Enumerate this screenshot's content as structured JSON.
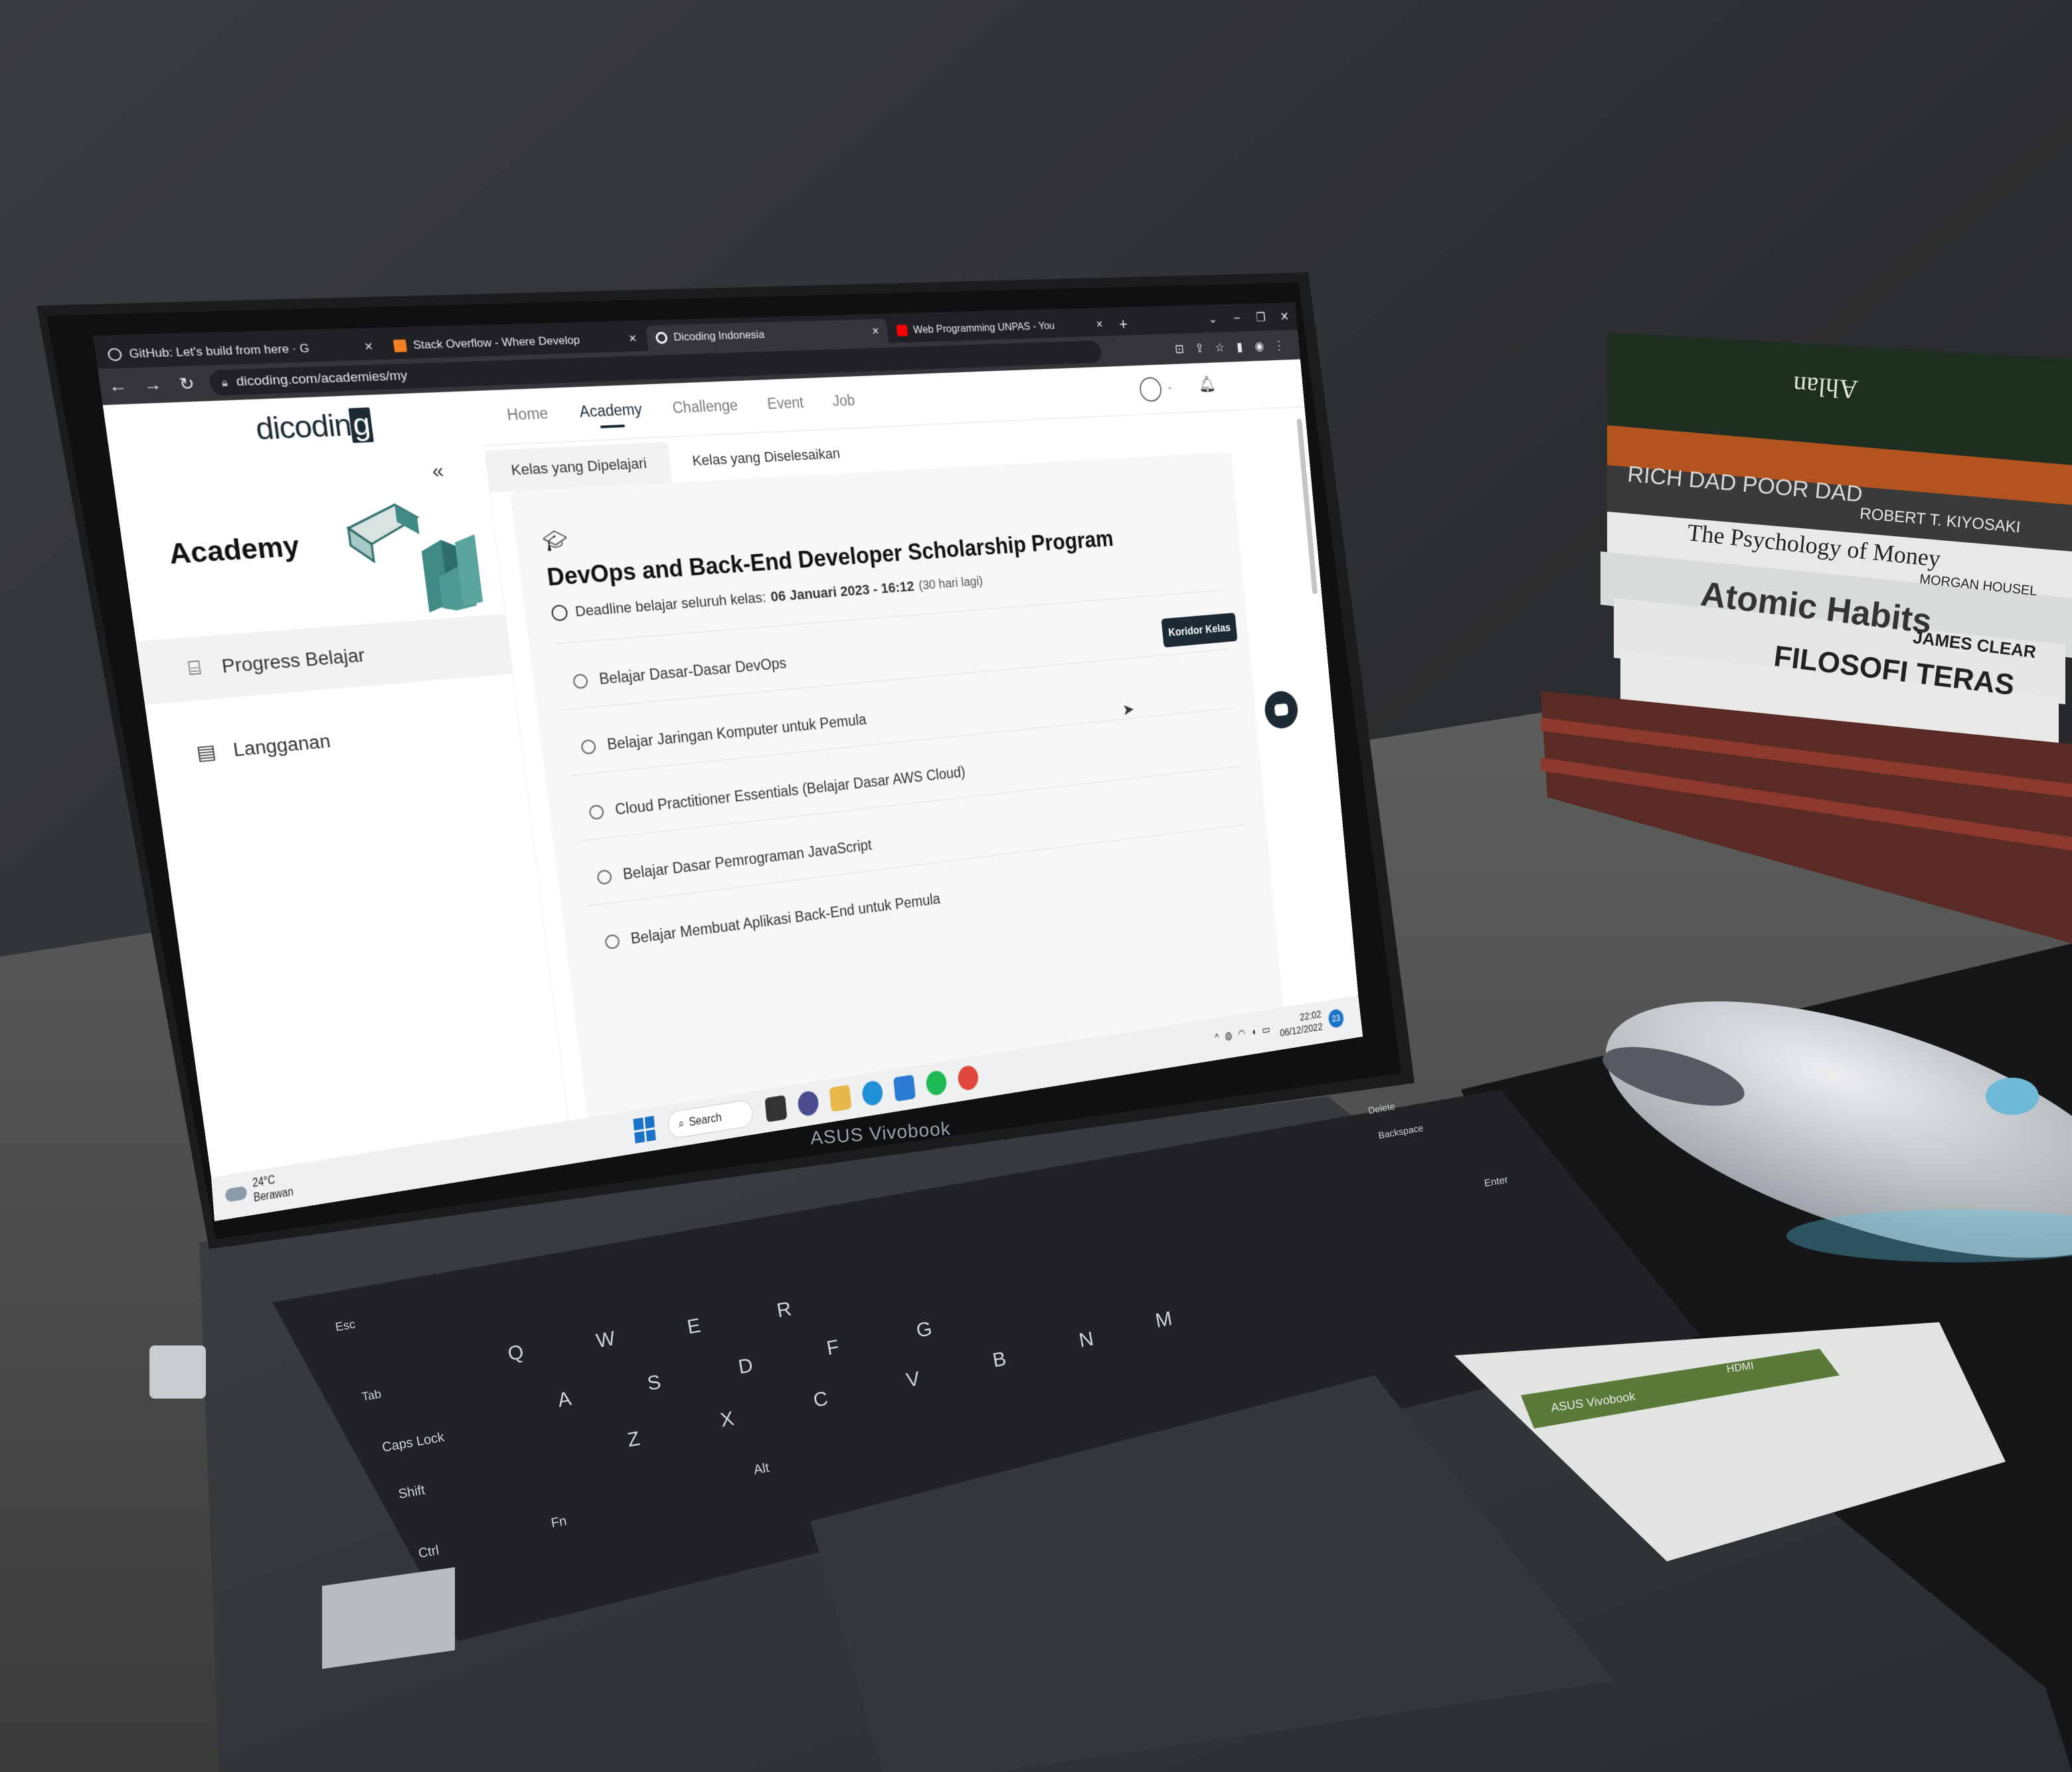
{
  "browser": {
    "tabs": [
      {
        "label": "GitHub: Let's build from here · G",
        "favicon_color": "#dddddd",
        "active": false
      },
      {
        "label": "Stack Overflow - Where Develop",
        "favicon_color": "#f48024",
        "active": false
      },
      {
        "label": "Dicoding Indonesia",
        "favicon_color": "#ffffff",
        "active": true
      },
      {
        "label": "Web Programming UNPAS - You",
        "favicon_color": "#ff0000",
        "active": false
      }
    ],
    "tab_close": "×",
    "new_tab": "+",
    "window_controls": [
      "⌄",
      "–",
      "❐",
      "✕"
    ],
    "url": "dicoding.com/academies/my"
  },
  "site": {
    "logo_prefix": "dicodin",
    "logo_suffix": "g",
    "nav": [
      "Home",
      "Academy",
      "Challenge",
      "Event",
      "Job"
    ],
    "nav_active": "Academy",
    "collapse_icon": "«",
    "sidebar_title": "Academy",
    "sidebar_items": [
      {
        "label": "Progress Belajar",
        "icon": "progress-icon",
        "active": true
      },
      {
        "label": "Langganan",
        "icon": "document-icon",
        "active": false
      }
    ],
    "subtabs": [
      "Kelas yang Dipelajari",
      "Kelas yang Diselesaikan"
    ],
    "card": {
      "title": "DevOps and Back-End Developer Scholarship Program",
      "deadline_label": "Deadline belajar seluruh kelas:",
      "deadline_date": "06 Januari 2023 - 16:12",
      "deadline_remaining": "(30 hari lagi)",
      "courses": [
        "Belajar Dasar-Dasar DevOps",
        "Belajar Jaringan Komputer untuk Pemula",
        "Cloud Practitioner Essentials (Belajar Dasar AWS Cloud)",
        "Belajar Dasar Pemrograman JavaScript",
        "Belajar Membuat Aplikasi Back-End untuk Pemula"
      ],
      "button": "Koridor Kelas"
    }
  },
  "taskbar": {
    "temperature": "24°C",
    "weather": "Berawan",
    "search": "Search",
    "time": "22:02",
    "date": "06/12/2022",
    "notifications": "23"
  },
  "laptop": {
    "brand_bezel": "ASUS Vivobook",
    "keys": [
      "Esc",
      "Q",
      "W",
      "E",
      "R",
      "A",
      "S",
      "D",
      "F",
      "G",
      "Z",
      "X",
      "C",
      "V",
      "B",
      "N",
      "M",
      "Tab",
      "Caps Lock",
      "Shift",
      "Ctrl",
      "Fn",
      "Alt",
      "Enter",
      "Backspace",
      "Delete"
    ],
    "sticker_brand": "ASUS Vivobook",
    "sticker_hdmi": "HDMI"
  },
  "books": [
    "Ahlan",
    "RICH DAD POOR DAD",
    "ROBERT T. KIYOSAKI",
    "The Psychology of Money",
    "MORGAN HOUSEL",
    "Atomic Habits",
    "JAMES CLEAR",
    "FILOSOFI TERAS"
  ],
  "colors": {
    "accent": "#1c2a34",
    "wall": "#2a2c2e",
    "desk": "#6d6e6b",
    "chrome_dark": "#202124"
  }
}
